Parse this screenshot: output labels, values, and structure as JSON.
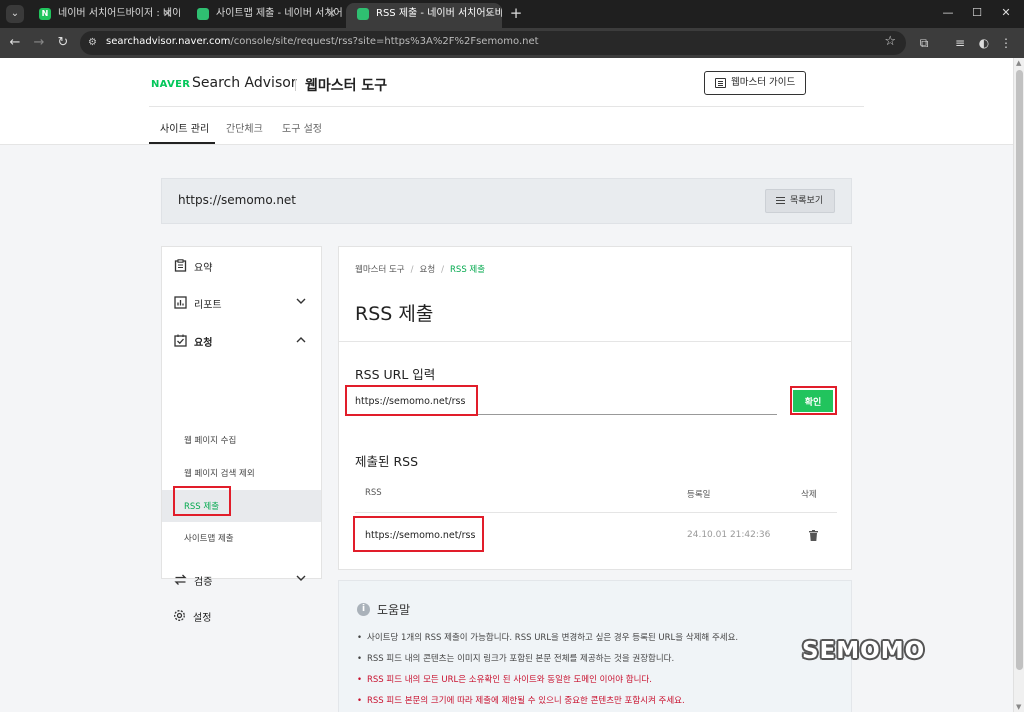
{
  "browser": {
    "tabs": [
      {
        "title": "네이버 서치어드바이저 : 네이버",
        "favicon": "naver-n-icon"
      },
      {
        "title": "사이트맵 제출 - 네이버 서치어",
        "favicon": "green-page-icon"
      },
      {
        "title": "RSS 제출 - 네이버 서치어드바이",
        "favicon": "green-page-icon",
        "active": true
      }
    ],
    "url_host": "searchadvisor.naver.com",
    "url_path": "/console/site/request/rss?site=https%3A%2F%2Fsemomo.net"
  },
  "header": {
    "brand": "NAVER",
    "product": "Search Advisor",
    "section": "웹마스터 도구",
    "guide_button": "웹마스터 가이드",
    "nav": [
      "사이트 관리",
      "간단체크",
      "도구 설정"
    ]
  },
  "site": {
    "url": "https://semomo.net",
    "list_button": "목록보기"
  },
  "sidebar": {
    "items": [
      {
        "label": "요약"
      },
      {
        "label": "리포트"
      },
      {
        "label": "요청"
      },
      {
        "label": "검증"
      },
      {
        "label": "설정"
      }
    ],
    "sub_items": [
      "웹 페이지 수집",
      "웹 페이지 검색 제외",
      "RSS 제출",
      "사이트맵 제출"
    ]
  },
  "main": {
    "breadcrumb": [
      "웹마스터 도구",
      "요청",
      "RSS 제출"
    ],
    "title": "RSS 제출",
    "input_section_title": "RSS URL 입력",
    "input_value": "https://semomo.net/rss",
    "confirm_button": "확인",
    "submitted_title": "제출된 RSS",
    "table": {
      "headers": [
        "RSS",
        "등록일",
        "삭제"
      ],
      "rows": [
        {
          "rss": "https://semomo.net/rss",
          "date": "24.10.01 21:42:36"
        }
      ]
    }
  },
  "help": {
    "title": "도움말",
    "items": [
      {
        "text": "사이트당 1개의 RSS 제출이 가능합니다. RSS URL을 변경하고 싶은 경우 등록된 URL을 삭제해 주세요.",
        "red": false
      },
      {
        "text": "RSS 피드 내의 콘텐츠는 이미지 링크가 포함된 본문 전체를 제공하는 것을 권장합니다.",
        "red": false
      },
      {
        "text": "RSS 피드 내의 모든 URL은 소유확인 된 사이트와 동일한 도메인 이어야 합니다.",
        "red": true
      },
      {
        "text": "RSS 피드 본문의 크기에 따라 제출에 제한될 수 있으니 중요한 콘텐츠만 포함시켜 주세요.",
        "red": true
      }
    ]
  },
  "watermark": "SEMOMO",
  "colors": {
    "accent_green": "#21c45d",
    "highlight_red": "#e11d2a",
    "warning_red": "#c8102e"
  }
}
